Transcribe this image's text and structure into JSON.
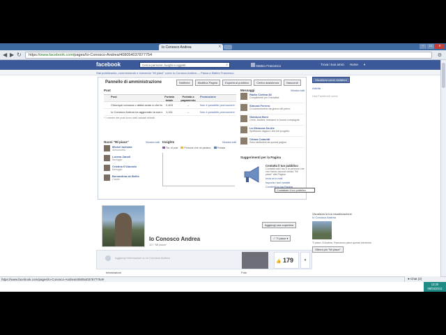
{
  "browser": {
    "tab_title": "Io Conosco Andrea",
    "tab_close": "x",
    "url_scheme": "https://",
    "url_host": "www.facebook.com",
    "url_path": "/pages/Io-Conosco-Andrea/408054037877754",
    "nav": {
      "back": "◀",
      "forward": "▶",
      "reload": "↻"
    },
    "window_buttons": [
      "–",
      "▭",
      "x"
    ]
  },
  "fb": {
    "logo": "facebook",
    "search_placeholder": "Cerca persone, luoghi e oggetti",
    "user_name": "Matteo Francesco",
    "friends_link": "Trova i tuoi amici",
    "home_link": "Home",
    "sub_notice": "Stai pubblicando, commentando e ricevendo \"Mi piace\" come Io Conosco Andrea — Passa a Matteo Francesco"
  },
  "admin": {
    "title": "Pannello di amministrazione",
    "buttons": [
      "Notifiche",
      "Modifica Pagina",
      "Esporta al pubblico",
      "Centro assistenza",
      "Nascondi"
    ],
    "posts": {
      "heading": "Post",
      "columns": [
        "Post",
        "Portata totale",
        "Portata a pagamento",
        "Promozione"
      ],
      "rows": [
        {
          "post": "Chiunque conosca o abbia avuto a che fare con Andrea",
          "reach": "2,403",
          "paid": "--",
          "promo": "Non è possibile promuovere"
        },
        {
          "post": "Io Conosco Andrea ha aggiornato la sua immagine",
          "reach": "1,411",
          "paid": "--",
          "promo": "Non è possibile promuovere"
        }
      ],
      "note": "* I numeri dei post sono stati valutati stimati"
    },
    "messages": {
      "heading": "Messaggi",
      "see_all": "Mostra tutti",
      "items": [
        {
          "name": "Radio Cortina 84",
          "text": "Complimenti per l'iniziativa"
        },
        {
          "name": "Simona Ferrero",
          "text": "Ci conoscevamo da giorno del primo"
        },
        {
          "name": "Gianluca Boni",
          "text": "Certo, Andrea, eravamo in buona compagnia"
        },
        {
          "name": "La Ghiaccia Da Ale",
          "text": "Spettacolo ragazzi, che bel progetto"
        },
        {
          "name": "Chiara Colavitti",
          "text": "Sono tantissimi da questa pagina"
        }
      ]
    },
    "new_likes": {
      "heading": "Nuovi \"Mi piace\"",
      "see_all": "Mostra tutti",
      "items": [
        {
          "name": "Michel Iachana",
          "place": "Alessandria"
        },
        {
          "name": "Lorena Zanoli",
          "place": "Bareggio"
        },
        {
          "name": "Cristina D'Abundo",
          "place": "Bareggio"
        },
        {
          "name": "Bernardina de Bellis",
          "place": "Casale"
        }
      ]
    },
    "insights": {
      "heading": "Insights",
      "see_all": "Mostra tutti",
      "legend": [
        "Tot. di post",
        "Persone che ne parlano",
        "Portata"
      ],
      "legend_colors": [
        "#8b5a9a",
        "#e0b94b",
        "#5a7fb0"
      ]
    },
    "suggest": {
      "heading": "Suggerimenti per la Pagina",
      "title": "Contatta il tuo pubblico",
      "body": "Contatta tutti i fan e le persone che non hanno ancora messo \"Mi piace\" alla Pagina",
      "links": [
        "Invia un'e-mail",
        "Importa i tuoi contatti",
        "Condividi la tua Pagina"
      ],
      "tooltip": "Contattate il tuo pubblico"
    }
  },
  "right": {
    "button": "Visualizza come visitatore",
    "link1": "Attività",
    "link2": "Usa Facebook come",
    "lower_heading": "Visualizza la tua visualizzazione",
    "lower_name": "Io Conosco Andrea",
    "lower_text": "Ti piace. A Andrea, Francesco piace questo elemento",
    "lower_button": "Ottieni più \"Mi piace\""
  },
  "profile": {
    "add_cover": "Aggiungi una copertina",
    "name": "Io Conosco Andrea",
    "likes_line": "117 \"Mi piace\"",
    "like_button": "Ti piace",
    "info_text": "Aggiungi informazioni su Io Conosco Andrea",
    "likes_count": "179",
    "info_label": "Informazioni",
    "photo_label": "Foto"
  },
  "status": {
    "url": "https://www.facebook.com/pages/Io-Conosco-Andrea/408054037877754#",
    "chat": "Chat",
    "chat_count": "(2)",
    "time": "13:20",
    "date": "08/04/2013"
  }
}
